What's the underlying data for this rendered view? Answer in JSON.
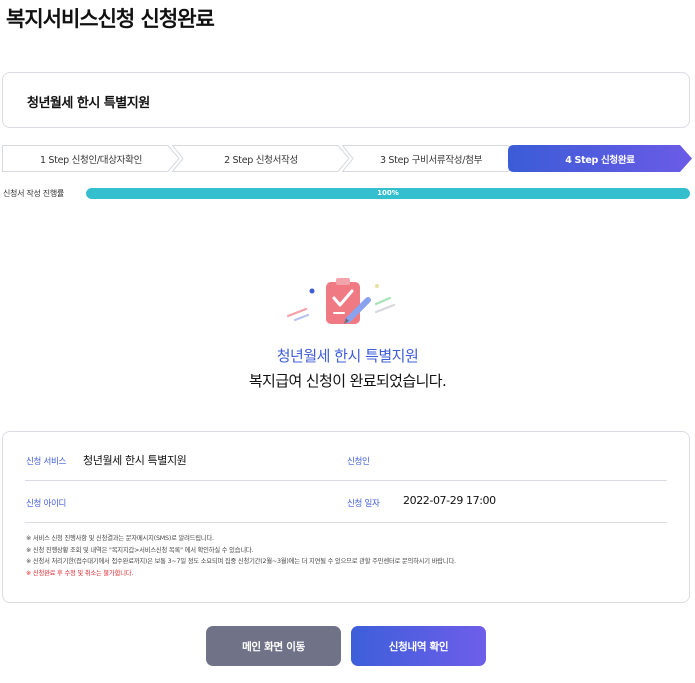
{
  "page_title": "복지서비스신청 신청완료",
  "service_name": "청년월세 한시 특별지원",
  "steps": [
    {
      "label": "1 Step 신청인/대상자확인",
      "active": false
    },
    {
      "label": "2 Step 신청서작성",
      "active": false
    },
    {
      "label": "3 Step 구비서류작성/첨부",
      "active": false
    },
    {
      "label": "4 Step 신청완료",
      "active": true
    }
  ],
  "progress": {
    "label": "신청서 작성 진행률",
    "percent": 100,
    "text": "100%"
  },
  "completion": {
    "service_name": "청년월세 한시 특별지원",
    "message": "복지급여 신청이 완료되었습니다."
  },
  "info": {
    "service_label": "신청 서비스",
    "service_value": "청년월세 한시 특별지원",
    "applicant_label": "신청인",
    "applicant_value": "",
    "id_label": "신청 아이디",
    "id_value": "",
    "date_label": "신청 일자",
    "date_value": "2022-07-29 17:00"
  },
  "notes": [
    "※ 서비스 신청 진행사항 및 신청결과는 문자메시지(SMS)로 알려드립니다.",
    "※ 신청 진행상황 조회 및 내역은 \"복지지갑>서비스신청 목록\" 에서 확인하실 수 있습니다.",
    "※ 신청서 처리기한(접수대기에서 접수완료까지)은 보통 3~7일 정도 소요되며 집중 신청기간(2월~3월)에는 더 지연될 수 있으므로 관할 주민센터로 문의하시기 바랍니다."
  ],
  "warning_note": "※ 신청완료 후 수정 및 취소는 불가합니다.",
  "buttons": {
    "main": "메인 화면 이동",
    "history": "신청내역 확인"
  },
  "colors": {
    "accent": "#3f5cd8",
    "progress": "#34bfcf",
    "warning": "#e0262f"
  }
}
